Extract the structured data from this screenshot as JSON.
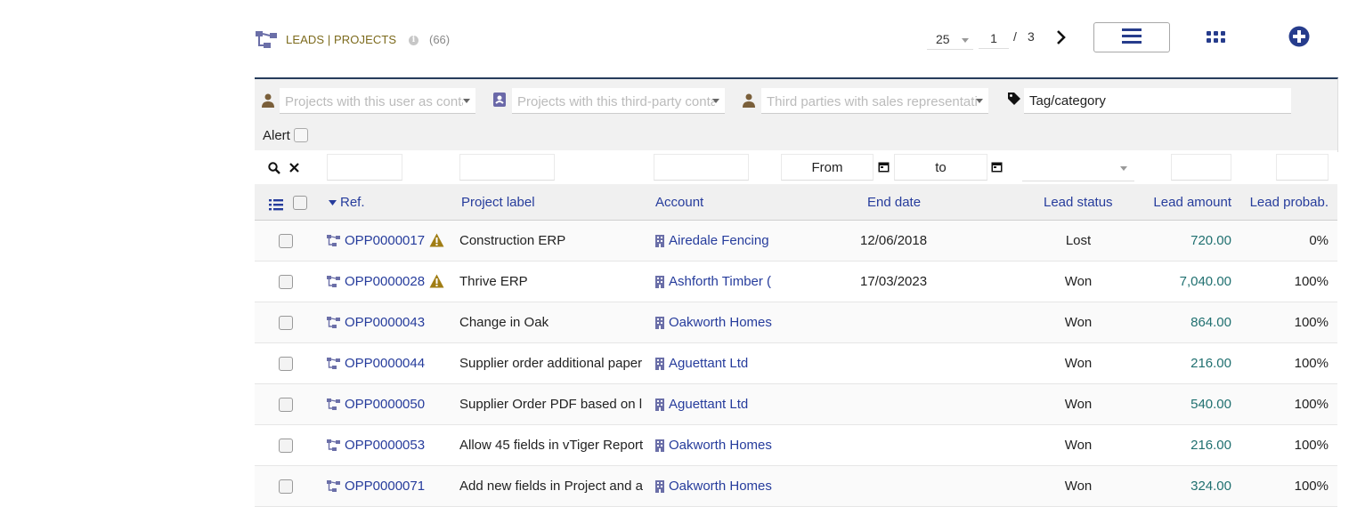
{
  "header": {
    "title": "LEADS | PROJECTS",
    "count": "(66)",
    "info_glyph": "i",
    "limit": "25",
    "page_current": "1",
    "page_separator": "/",
    "page_total": "3",
    "icons": [
      "project-icon",
      "info-icon",
      "next-page-icon",
      "list-view-icon",
      "kanban-view-icon",
      "add-icon"
    ]
  },
  "filters": {
    "user_contact_placeholder": "Projects with this user as contact",
    "thirdparty_contact_placeholder": "Projects with this third-party contact",
    "sales_rep_placeholder": "Third parties with sales representative",
    "tag_label": "Tag/category",
    "alert_label": "Alert"
  },
  "search": {
    "date_from": "From",
    "date_to": "to"
  },
  "columns": {
    "ref": "Ref.",
    "label": "Project label",
    "account": "Account",
    "end_date": "End date",
    "status": "Lead status",
    "amount": "Lead amount",
    "probability": "Lead probab."
  },
  "rows": [
    {
      "ref": "OPP0000017",
      "warning": true,
      "label": "Construction ERP",
      "account": "Airedale Fencing",
      "end_date": "12/06/2018",
      "status": "Lost",
      "amount": "720.00",
      "probability": "0%"
    },
    {
      "ref": "OPP0000028",
      "warning": true,
      "label": "Thrive ERP",
      "account": "Ashforth Timber (",
      "end_date": "17/03/2023",
      "status": "Won",
      "amount": "7,040.00",
      "probability": "100%"
    },
    {
      "ref": "OPP0000043",
      "warning": false,
      "label": "Change in Oak",
      "account": "Oakworth Homes",
      "end_date": "",
      "status": "Won",
      "amount": "864.00",
      "probability": "100%"
    },
    {
      "ref": "OPP0000044",
      "warning": false,
      "label": "Supplier order additional paper",
      "account": "Aguettant Ltd",
      "end_date": "",
      "status": "Won",
      "amount": "216.00",
      "probability": "100%"
    },
    {
      "ref": "OPP0000050",
      "warning": false,
      "label": "Supplier Order PDF based on l",
      "account": "Aguettant Ltd",
      "end_date": "",
      "status": "Won",
      "amount": "540.00",
      "probability": "100%"
    },
    {
      "ref": "OPP0000053",
      "warning": false,
      "label": "Allow 45 fields in vTiger Report",
      "account": "Oakworth Homes",
      "end_date": "",
      "status": "Won",
      "amount": "216.00",
      "probability": "100%"
    },
    {
      "ref": "OPP0000071",
      "warning": false,
      "label": "Add new fields in Project and a",
      "account": "Oakworth Homes",
      "end_date": "",
      "status": "Won",
      "amount": "324.00",
      "probability": "100%"
    }
  ],
  "colors": {
    "link": "#263c9c",
    "title": "#7c6a1c",
    "amount": "#207070",
    "warning": "#a07d14",
    "panel_border": "#263c5c"
  }
}
